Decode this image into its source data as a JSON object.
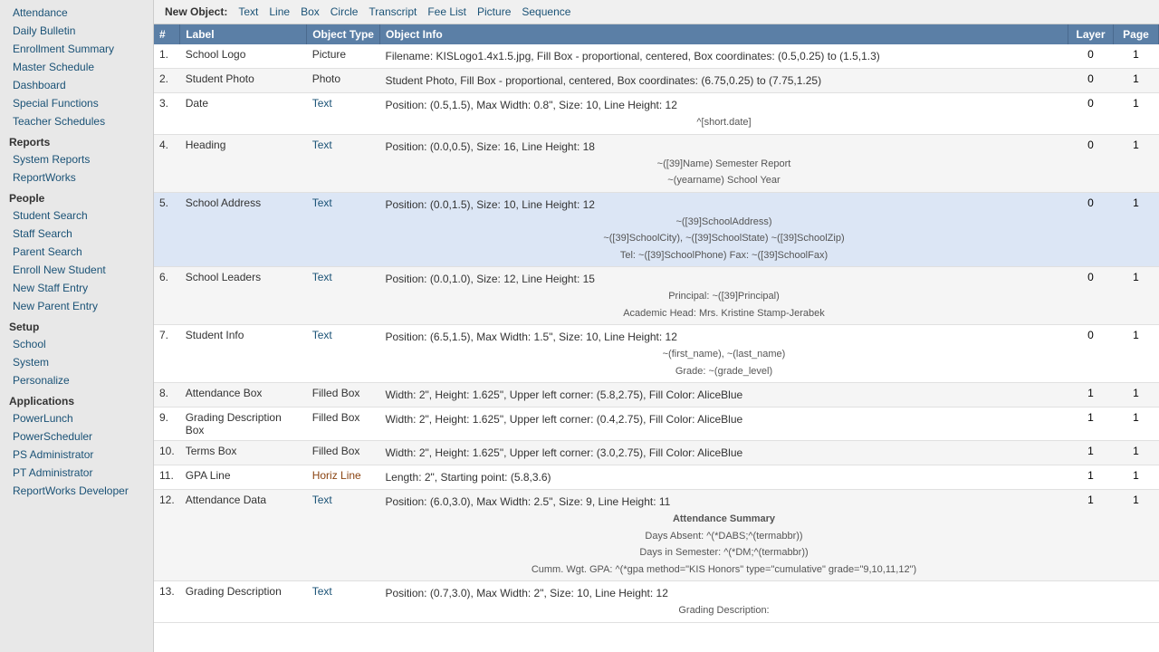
{
  "sidebar": {
    "sections": [
      {
        "label": "",
        "items": [
          {
            "name": "sidebar-attendance",
            "label": "Attendance"
          },
          {
            "name": "sidebar-daily-bulletin",
            "label": "Daily Bulletin"
          },
          {
            "name": "sidebar-enrollment-summary",
            "label": "Enrollment Summary"
          },
          {
            "name": "sidebar-master-schedule",
            "label": "Master Schedule"
          },
          {
            "name": "sidebar-dashboard",
            "label": "Dashboard"
          },
          {
            "name": "sidebar-special-functions",
            "label": "Special Functions"
          },
          {
            "name": "sidebar-teacher-schedules",
            "label": "Teacher Schedules"
          }
        ]
      },
      {
        "label": "Reports",
        "items": [
          {
            "name": "sidebar-system-reports",
            "label": "System Reports"
          },
          {
            "name": "sidebar-reportworks",
            "label": "ReportWorks"
          }
        ]
      },
      {
        "label": "People",
        "items": [
          {
            "name": "sidebar-student-search",
            "label": "Student Search"
          },
          {
            "name": "sidebar-staff-search",
            "label": "Staff Search"
          },
          {
            "name": "sidebar-parent-search",
            "label": "Parent Search"
          },
          {
            "name": "sidebar-enroll-new-student",
            "label": "Enroll New Student"
          },
          {
            "name": "sidebar-new-staff-entry",
            "label": "New Staff Entry"
          },
          {
            "name": "sidebar-new-parent-entry",
            "label": "New Parent Entry"
          }
        ]
      },
      {
        "label": "Setup",
        "items": [
          {
            "name": "sidebar-school",
            "label": "School"
          },
          {
            "name": "sidebar-system",
            "label": "System"
          },
          {
            "name": "sidebar-personalize",
            "label": "Personalize"
          }
        ]
      },
      {
        "label": "Applications",
        "items": [
          {
            "name": "sidebar-powerlunch",
            "label": "PowerLunch"
          },
          {
            "name": "sidebar-powerscheduler",
            "label": "PowerScheduler"
          },
          {
            "name": "sidebar-ps-administrator",
            "label": "PS Administrator"
          },
          {
            "name": "sidebar-pt-administrator",
            "label": "PT Administrator"
          },
          {
            "name": "sidebar-reportworks-developer",
            "label": "ReportWorks Developer"
          }
        ]
      }
    ]
  },
  "toolbar": {
    "new_object_label": "New Object:",
    "links": [
      "Text",
      "Line",
      "Box",
      "Circle",
      "Transcript",
      "Fee List",
      "Picture",
      "Sequence"
    ]
  },
  "table": {
    "headers": [
      "#",
      "Label",
      "Object Type",
      "Object Info",
      "Layer",
      "Page"
    ],
    "rows": [
      {
        "num": "1.",
        "label": "School Logo",
        "type": "Picture",
        "info": "Filename: KISLogo1.4x1.5.jpg, Fill Box - proportional, centered, Box coordinates: (0.5,0.25) to (1.5,1.3)",
        "info_subs": [],
        "layer": "0",
        "page": "1",
        "highlighted": false,
        "type_class": ""
      },
      {
        "num": "2.",
        "label": "Student Photo",
        "type": "Photo",
        "info": "Student Photo, Fill Box - proportional, centered, Box coordinates: (6.75,0.25) to (7.75,1.25)",
        "info_subs": [],
        "layer": "0",
        "page": "1",
        "highlighted": false,
        "type_class": ""
      },
      {
        "num": "3.",
        "label": "Date",
        "type": "Text",
        "info": "Position: (0.5,1.5), Max Width: 0.8\", Size: 10, Line Height: 12",
        "info_subs": [
          "^[short.date]"
        ],
        "layer": "0",
        "page": "1",
        "highlighted": false,
        "type_class": "type-text"
      },
      {
        "num": "4.",
        "label": "Heading",
        "type": "Text",
        "info": "Position: (0.0,0.5), Size: 16, Line Height: 18",
        "info_subs": [
          "~([39]Name) Semester Report",
          "~(yearname) School Year"
        ],
        "layer": "0",
        "page": "1",
        "highlighted": false,
        "type_class": "type-text"
      },
      {
        "num": "5.",
        "label": "School Address",
        "type": "Text",
        "info": "Position: (0.0,1.5), Size: 10, Line Height: 12",
        "info_subs": [
          "~([39]SchoolAddress)",
          "~([39]SchoolCity), ~([39]SchoolState) ~([39]SchoolZip)",
          "Tel: ~([39]SchoolPhone) Fax: ~([39]SchoolFax)"
        ],
        "layer": "0",
        "page": "1",
        "highlighted": true,
        "type_class": "type-text"
      },
      {
        "num": "6.",
        "label": "School Leaders",
        "type": "Text",
        "info": "Position: (0.0,1.0), Size: 12, Line Height: 15",
        "info_subs": [
          "Principal: ~([39]Principal)",
          "Academic Head: Mrs. Kristine Stamp-Jerabek"
        ],
        "layer": "0",
        "page": "1",
        "highlighted": false,
        "type_class": "type-text"
      },
      {
        "num": "7.",
        "label": "Student Info",
        "type": "Text",
        "info": "Position: (6.5,1.5), Max Width: 1.5\", Size: 10, Line Height: 12",
        "info_subs": [
          "~(first_name), ~(last_name)",
          "Grade: ~(grade_level)"
        ],
        "layer": "0",
        "page": "1",
        "highlighted": false,
        "type_class": "type-text"
      },
      {
        "num": "8.",
        "label": "Attendance Box",
        "type": "Filled Box",
        "info": "Width: 2\", Height: 1.625\", Upper left corner: (5.8,2.75), Fill Color: AliceBlue",
        "info_subs": [],
        "layer": "1",
        "page": "1",
        "highlighted": false,
        "type_class": ""
      },
      {
        "num": "9.",
        "label": "Grading Description Box",
        "type": "Filled Box",
        "info": "Width: 2\", Height: 1.625\", Upper left corner: (0.4,2.75), Fill Color: AliceBlue",
        "info_subs": [],
        "layer": "1",
        "page": "1",
        "highlighted": false,
        "type_class": ""
      },
      {
        "num": "10.",
        "label": "Terms Box",
        "type": "Filled Box",
        "info": "Width: 2\", Height: 1.625\", Upper left corner: (3.0,2.75), Fill Color: AliceBlue",
        "info_subs": [],
        "layer": "1",
        "page": "1",
        "highlighted": false,
        "type_class": ""
      },
      {
        "num": "11.",
        "label": "GPA Line",
        "type": "Horiz Line",
        "info": "Length: 2\", Starting point: (5.8,3.6)",
        "info_subs": [],
        "layer": "1",
        "page": "1",
        "highlighted": false,
        "type_class": "horiz-line"
      },
      {
        "num": "12.",
        "label": "Attendance Data",
        "type": "Text",
        "info": "Position: (6.0,3.0), Max Width: 2.5\", Size: 9, Line Height: 11",
        "info_subs": [
          "Attendance Summary",
          "Days Absent: ^(*DABS;^(termabbr))",
          "Days in Semester: ^(*DM;^(termabbr))",
          "",
          "",
          "Cumm. Wgt. GPA: ^(*gpa method=\"KIS Honors\" type=\"cumulative\" grade=\"9,10,11,12\")"
        ],
        "layer": "1",
        "page": "1",
        "highlighted": false,
        "type_class": "type-text"
      },
      {
        "num": "13.",
        "label": "Grading Description",
        "type": "Text",
        "info": "Position: (0.7,3.0), Max Width: 2\", Size: 10, Line Height: 12",
        "info_subs": [
          "Grading Description:"
        ],
        "layer": "",
        "page": "",
        "highlighted": false,
        "type_class": "type-text"
      }
    ]
  }
}
